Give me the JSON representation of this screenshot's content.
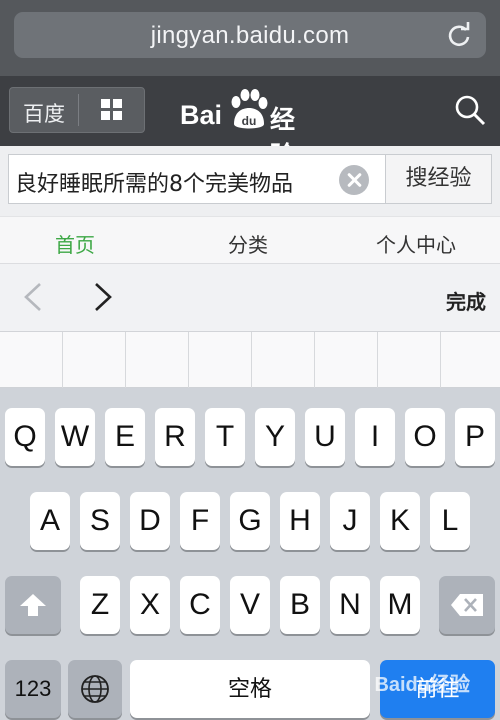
{
  "browser": {
    "url": "jingyan.baidu.com"
  },
  "header": {
    "baidu_label": "百度",
    "logo_text_bai": "Bai",
    "logo_text_du": "du",
    "logo_text_jingyan": "经验"
  },
  "search": {
    "query": "良好睡眠所需的8个完美物品",
    "button_label": "搜经验"
  },
  "tabs": [
    {
      "label": "首页",
      "active": true
    },
    {
      "label": "分类",
      "active": false
    },
    {
      "label": "个人中心",
      "active": false
    }
  ],
  "accessory": {
    "done_label": "完成"
  },
  "keyboard": {
    "row1": [
      "Q",
      "W",
      "E",
      "R",
      "T",
      "Y",
      "U",
      "I",
      "O",
      "P"
    ],
    "row2": [
      "A",
      "S",
      "D",
      "F",
      "G",
      "H",
      "J",
      "K",
      "L"
    ],
    "row3": [
      "Z",
      "X",
      "C",
      "V",
      "B",
      "N",
      "M"
    ],
    "numbers_label": "123",
    "space_label": "空格",
    "return_label": "前往"
  },
  "watermark": "Baidu经验",
  "colors": {
    "active_tab": "#3ea846",
    "return_key": "#1f7ff0"
  }
}
